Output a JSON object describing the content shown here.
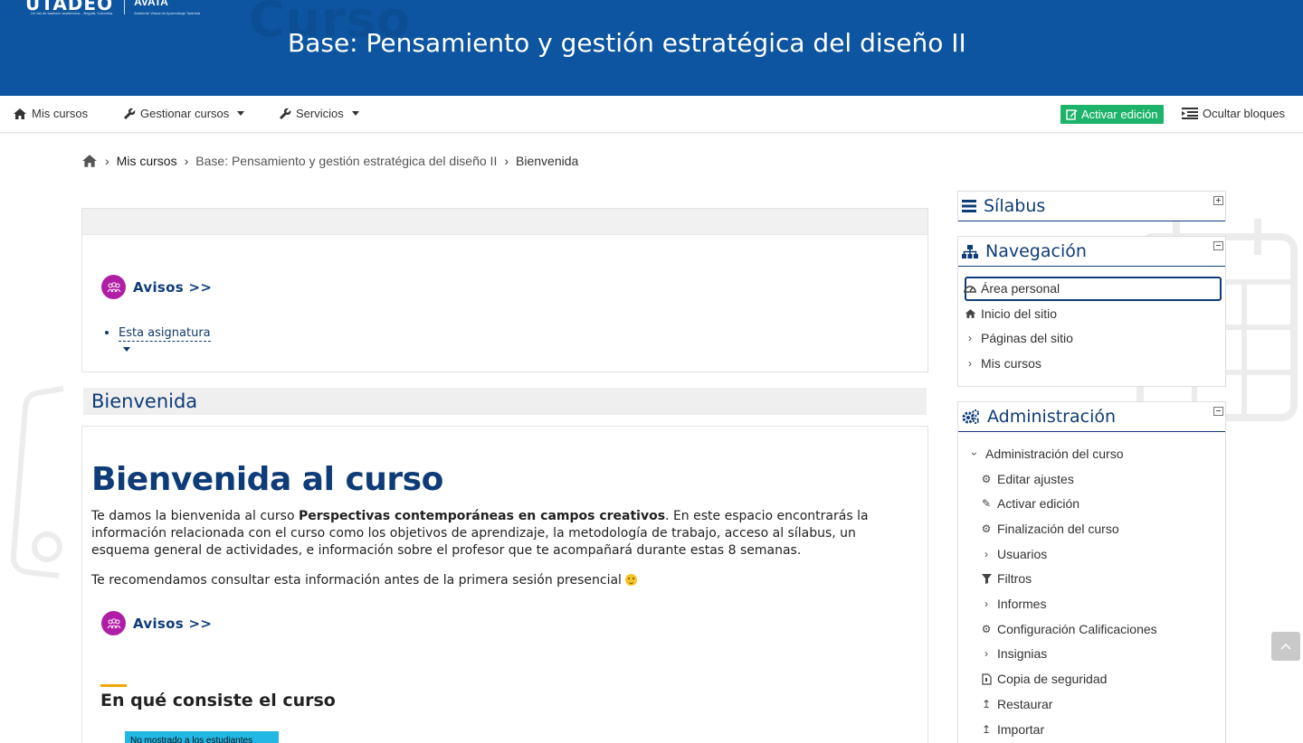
{
  "header": {
    "logo_text": "UTADEO",
    "logo_subtext": "Un día de tradición académica... Bogotá, Colombia",
    "avata_text": "AVATA",
    "avata_subtext": "Ambiente Virtual de Aprendizaje Tadeísta",
    "ghost_text": "Curso",
    "course_title": "Base: Pensamiento y gestión estratégica del diseño II"
  },
  "topnav": {
    "mis_cursos": "Mis cursos",
    "gestionar": "Gestionar cursos",
    "servicios": "Servicios",
    "activar_edicion": "Activar edición",
    "ocultar_bloques": "Ocultar bloques"
  },
  "breadcrumb": {
    "mis_cursos": "Mis cursos",
    "course": "Base: Pensamiento y gestión estratégica del diseño II",
    "current": "Bienvenida"
  },
  "main": {
    "avisos_label": "Avisos >>",
    "esta_asignatura": "Esta asignatura",
    "section_title": "Bienvenida",
    "heading": "Bienvenida al curso",
    "paragraph1_start": "Te damos la bienvenida al curso ",
    "paragraph1_bold": "Perspectivas contemporáneas en campos creativos",
    "paragraph1_end": ". En este espacio encontrarás la información relacionada con el curso como los objetivos de aprendizaje, la metodología de trabajo, acceso al sílabus, un esquema general de actividades, e información sobre el profesor que te acompañará durante estas 8 semanas.",
    "paragraph2": "Te recomendamos consultar esta información antes de la primera sesión presencial",
    "avisos_label_2": "Avisos >>",
    "consiste_title": "En qué consiste el curso",
    "hidden_badge": "No mostrado a los estudiantes"
  },
  "blocks": {
    "silabus_title": "Sílabus",
    "navegacion_title": "Navegación",
    "navegacion_items": [
      "Área personal",
      "Inicio del sitio",
      "Páginas del sitio",
      "Mis cursos"
    ],
    "administracion_title": "Administración",
    "admin_root": "Administración del curso",
    "admin_items": [
      "Editar ajustes",
      "Activar edición",
      "Finalización del curso",
      "Usuarios",
      "Filtros",
      "Informes",
      "Configuración Calificaciones",
      "Insignias",
      "Copia de seguridad",
      "Restaurar",
      "Importar"
    ]
  },
  "colors": {
    "header_blue": "#0d55a0",
    "brand_navy": "#0e3c78",
    "edit_green": "#1eb36a",
    "avisos_purple": "#b11ea6",
    "hidden_badge_cyan": "#23b7e5",
    "accent_orange": "#f0a500"
  }
}
